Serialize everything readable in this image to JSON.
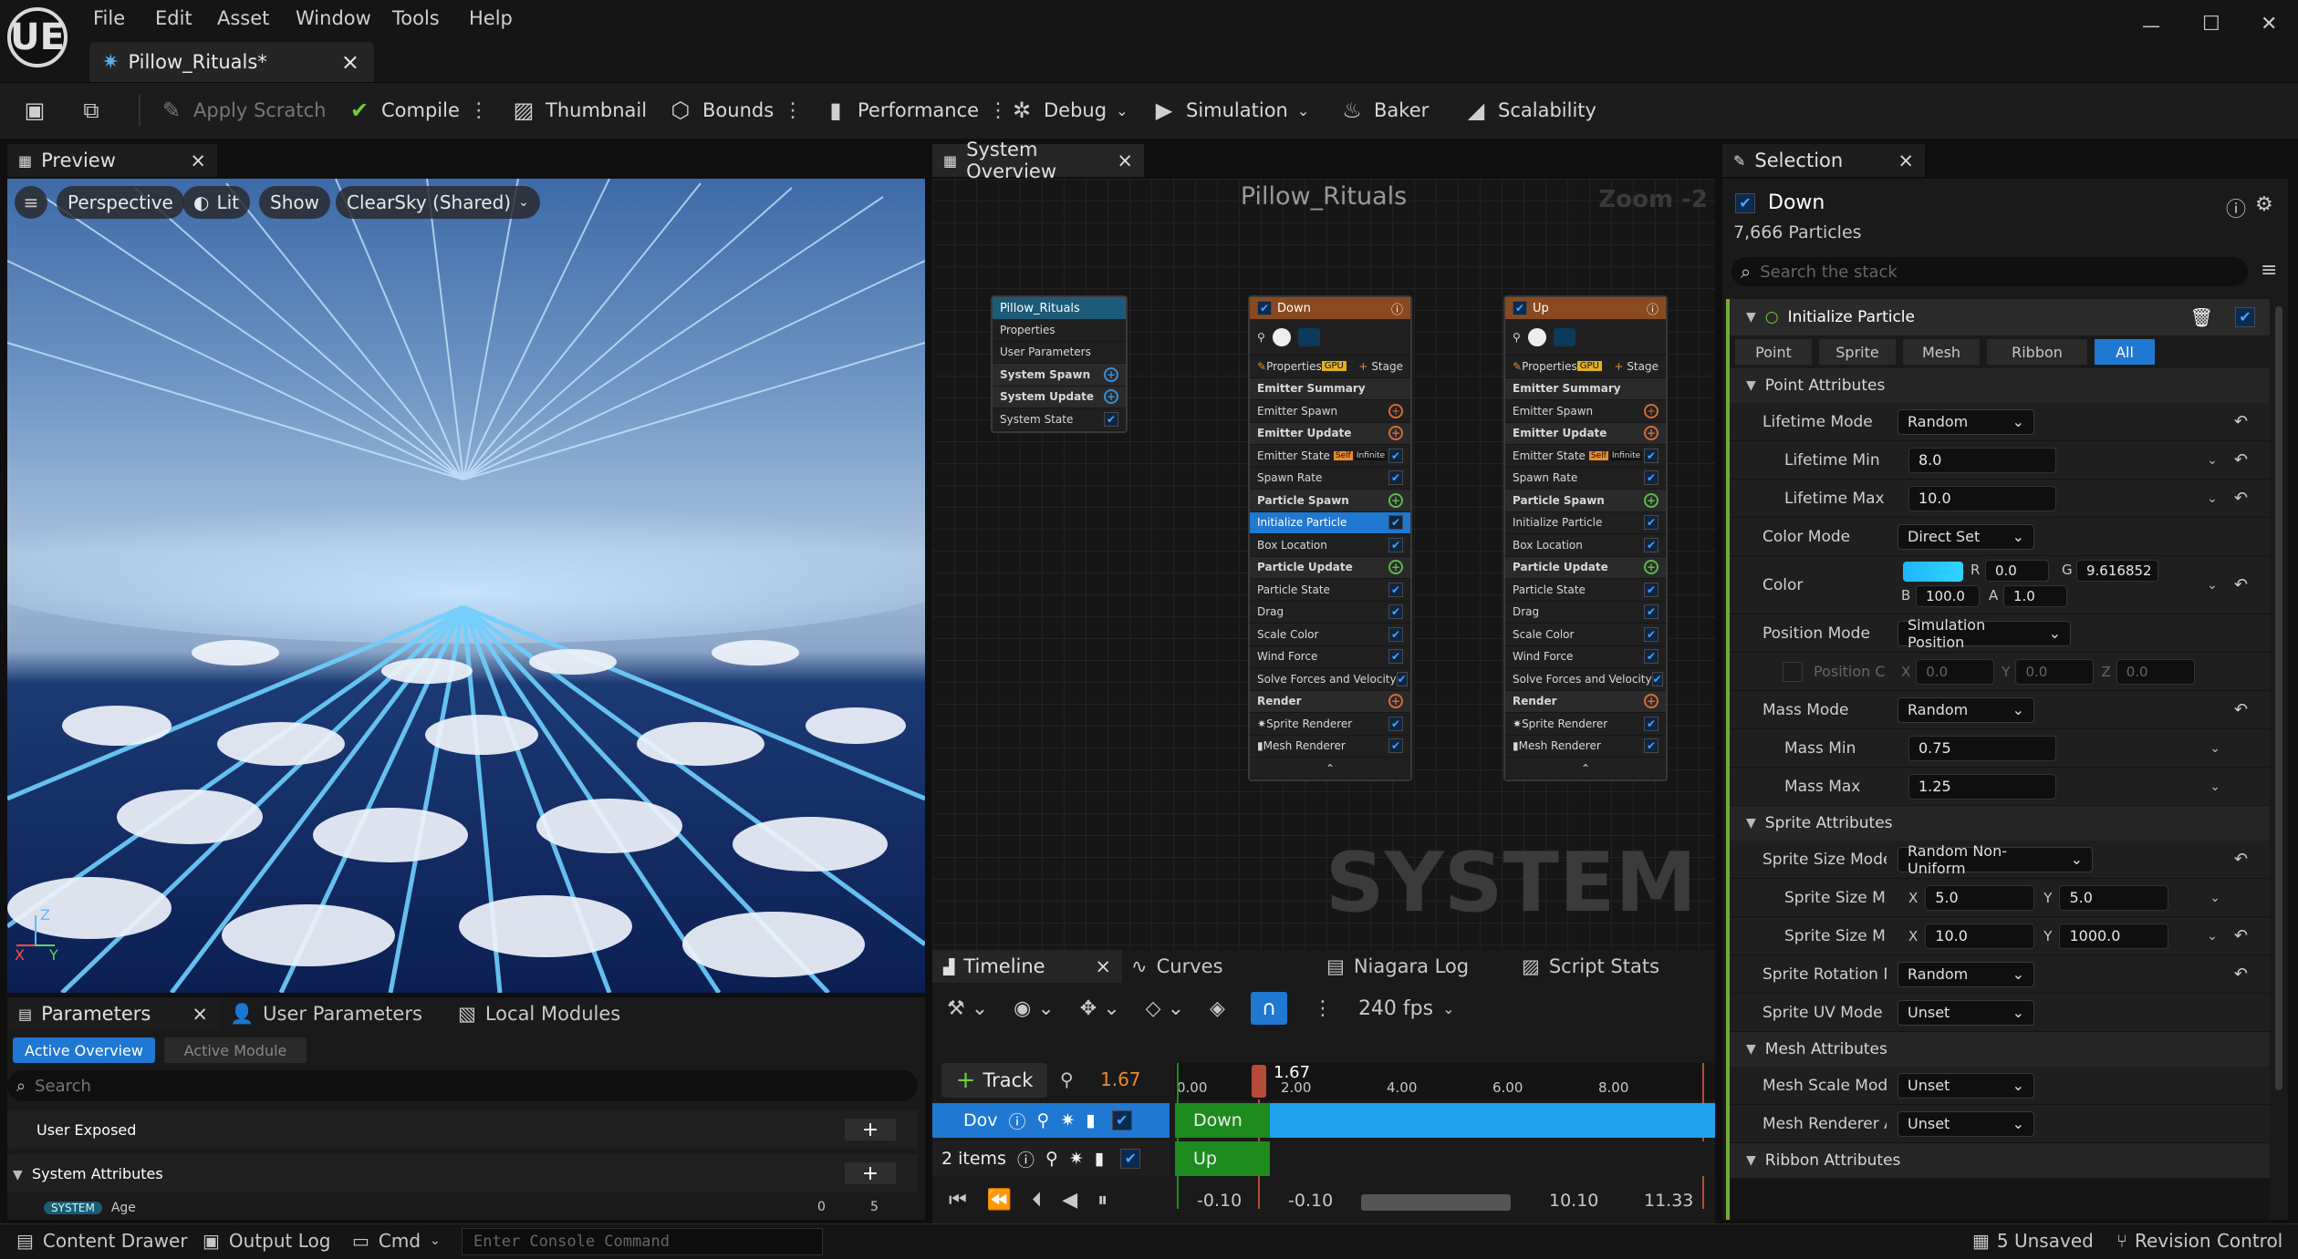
{
  "app": {
    "logo": "UE"
  },
  "menu": [
    "File",
    "Edit",
    "Asset",
    "Window",
    "Tools",
    "Help"
  ],
  "doc_tab": {
    "title": "Pillow_Rituals*",
    "close": "×"
  },
  "window_controls": {
    "minimize": "—",
    "maximize": "☐",
    "close": "✕"
  },
  "toolbar": {
    "apply_scratch": "Apply Scratch",
    "compile": "Compile",
    "thumbnail": "Thumbnail",
    "bounds": "Bounds",
    "performance": "Performance",
    "debug": "Debug",
    "simulation": "Simulation",
    "baker": "Baker",
    "scalability": "Scalability"
  },
  "preview": {
    "tab": "Preview",
    "close": "×",
    "perspective": "Perspective",
    "lit": "Lit",
    "show": "Show",
    "sky": "ClearSky (Shared)",
    "axis_x": "X",
    "axis_y": "Y",
    "axis_z": "Z"
  },
  "system_overview": {
    "tab": "System Overview",
    "close": "×",
    "title": "Pillow_Rituals",
    "zoom": "Zoom -2",
    "watermark": "SYSTEM",
    "system_node": {
      "title": "Pillow_Rituals",
      "rows": [
        "Properties",
        "User Parameters",
        "System Spawn",
        "System Update",
        "System State"
      ]
    },
    "emitters": [
      {
        "title": "Down",
        "badge": "GPU",
        "stage": "Stage",
        "rows": [
          "Properties",
          "Emitter Summary",
          "Emitter Spawn",
          "Emitter Update",
          "Emitter State",
          "Spawn Rate",
          "Particle Spawn",
          "Initialize Particle",
          "Box Location",
          "Particle Update",
          "Particle State",
          "Drag",
          "Scale Color",
          "Wind Force",
          "Solve Forces and Velocity",
          "Render",
          "Sprite Renderer",
          "Mesh Renderer"
        ],
        "self": "Self",
        "infinite": "Infinite"
      },
      {
        "title": "Up",
        "badge": "GPU",
        "stage": "Stage",
        "rows": [
          "Properties",
          "Emitter Summary",
          "Emitter Spawn",
          "Emitter Update",
          "Emitter State",
          "Spawn Rate",
          "Particle Spawn",
          "Initialize Particle",
          "Box Location",
          "Particle Update",
          "Particle State",
          "Drag",
          "Scale Color",
          "Wind Force",
          "Solve Forces and Velocity",
          "Render",
          "Sprite Renderer",
          "Mesh Renderer"
        ],
        "self": "Self",
        "infinite": "Infinite"
      }
    ]
  },
  "timeline": {
    "tabs": [
      "Timeline",
      "Curves",
      "Niagara Log",
      "Script Stats"
    ],
    "close": "×",
    "fps": "240 fps",
    "track_btn": "Track",
    "current_time": "1.67",
    "playhead_label": "1.67",
    "ruler": [
      "0.00",
      "2.00",
      "4.00",
      "6.00",
      "8.00"
    ],
    "tracks": [
      {
        "label": "Dov",
        "bar": "Down"
      },
      {
        "label": "2 items",
        "bar": "Up"
      }
    ],
    "range": [
      "-0.10",
      "-0.10",
      "10.10",
      "11.33"
    ]
  },
  "selection": {
    "tab": "Selection",
    "close": "×",
    "emitter": "Down",
    "particles": "7,666 Particles",
    "search_placeholder": "Search the stack",
    "module": "Initialize Particle",
    "filters": [
      "Point",
      "Sprite",
      "Mesh",
      "Ribbon",
      "All"
    ],
    "categories": {
      "point": "Point Attributes",
      "sprite": "Sprite Attributes",
      "mesh": "Mesh Attributes",
      "ribbon": "Ribbon Attributes"
    },
    "props": {
      "lifetime_mode": {
        "label": "Lifetime Mode",
        "value": "Random"
      },
      "lifetime_min": {
        "label": "Lifetime Min",
        "value": "8.0"
      },
      "lifetime_max": {
        "label": "Lifetime Max",
        "value": "10.0"
      },
      "color_mode": {
        "label": "Color Mode",
        "value": "Direct Set"
      },
      "color": {
        "label": "Color",
        "r_label": "R",
        "r": "0.0",
        "g_label": "G",
        "g": "9.616852",
        "b_label": "B",
        "b": "100.0",
        "a_label": "A",
        "a": "1.0",
        "swatch": "#1fb6ff"
      },
      "position_mode": {
        "label": "Position Mode",
        "value": "Simulation Position"
      },
      "position_c": {
        "label": "Position C",
        "x_label": "X",
        "x": "0.0",
        "y_label": "Y",
        "y": "0.0",
        "z_label": "Z",
        "z": "0.0"
      },
      "mass_mode": {
        "label": "Mass Mode",
        "value": "Random"
      },
      "mass_min": {
        "label": "Mass Min",
        "value": "0.75"
      },
      "mass_max": {
        "label": "Mass Max",
        "value": "1.25"
      },
      "sprite_size_mode": {
        "label": "Sprite Size Mode",
        "value": "Random Non-Uniform"
      },
      "sprite_size_min": {
        "label": "Sprite Size Mir",
        "x_label": "X",
        "x": "5.0",
        "y_label": "Y",
        "y": "5.0"
      },
      "sprite_size_max": {
        "label": "Sprite Size Ma",
        "x_label": "X",
        "x": "10.0",
        "y_label": "Y",
        "y": "1000.0"
      },
      "sprite_rotation": {
        "label": "Sprite Rotation Mc",
        "value": "Random"
      },
      "sprite_uv": {
        "label": "Sprite UV Mode",
        "value": "Unset"
      },
      "mesh_scale": {
        "label": "Mesh Scale Mode",
        "value": "Unset"
      },
      "mesh_renderer": {
        "label": "Mesh Renderer Ar",
        "value": "Unset"
      }
    }
  },
  "parameters": {
    "tabs": [
      "Parameters",
      "User Parameters",
      "Local Modules"
    ],
    "close": "×",
    "active_overview": "Active Overview",
    "active_module": "Active Module",
    "search_placeholder": "Search",
    "user_exposed": "User Exposed",
    "system_attributes": "System Attributes",
    "system_badge": "SYSTEM",
    "age": "Age",
    "age_val_a": "0",
    "age_val_b": "5"
  },
  "status": {
    "content_drawer": "Content Drawer",
    "output_log": "Output Log",
    "cmd": "Cmd",
    "console_placeholder": "Enter Console Command",
    "unsaved": "5 Unsaved",
    "revision": "Revision Control"
  },
  "colors": {
    "accent": "#1f78d1",
    "track_green": "#1e8b1e",
    "track_blue": "#1fa3ee",
    "emitter_header": "#8a4a1f",
    "system_header": "#1d5a78"
  }
}
